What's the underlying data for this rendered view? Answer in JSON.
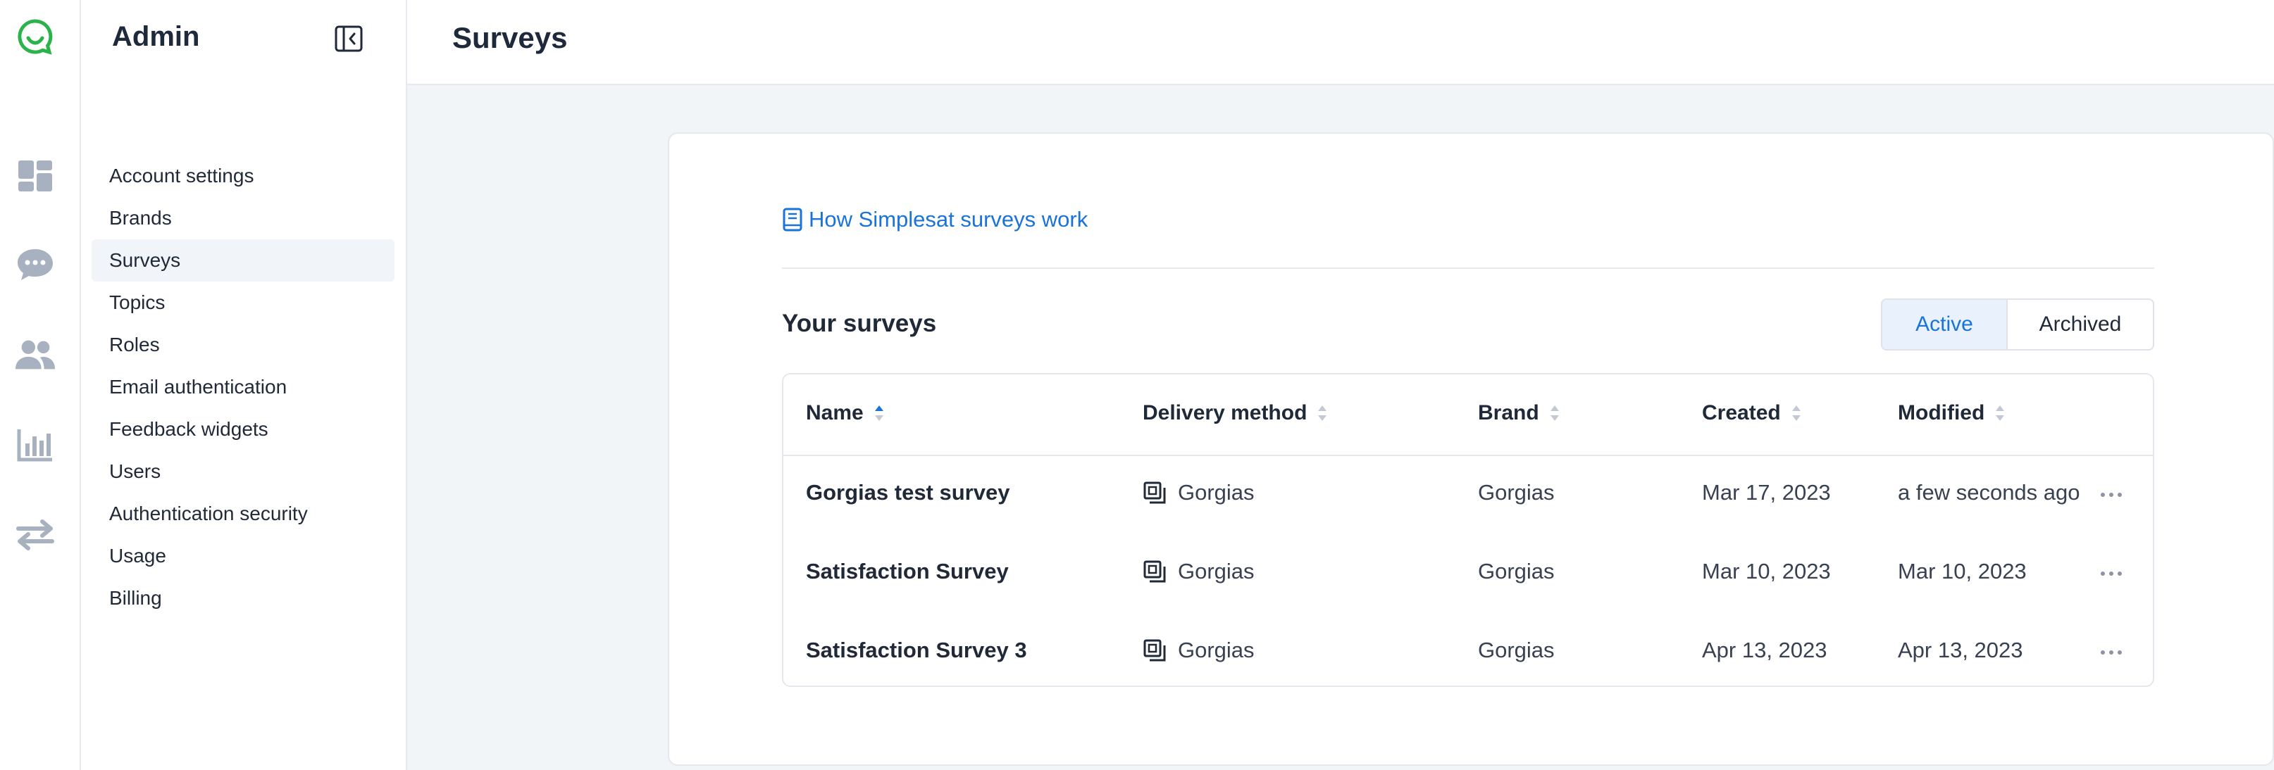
{
  "rail": {
    "icons": [
      "chat-logo-icon",
      "dashboard-icon",
      "conversations-icon",
      "people-icon",
      "analytics-icon",
      "integrations-icon"
    ],
    "colors": {
      "brand": "#2bb34b",
      "icon": "#a7b1bf"
    }
  },
  "sidebar": {
    "title": "Admin",
    "items": [
      {
        "label": "Account settings"
      },
      {
        "label": "Brands"
      },
      {
        "label": "Surveys"
      },
      {
        "label": "Topics"
      },
      {
        "label": "Roles"
      },
      {
        "label": "Email authentication"
      },
      {
        "label": "Feedback widgets"
      },
      {
        "label": "Users"
      },
      {
        "label": "Authentication security"
      },
      {
        "label": "Usage"
      },
      {
        "label": "Billing"
      }
    ],
    "active_item": "Surveys"
  },
  "header": {
    "title": "Surveys"
  },
  "main": {
    "help_link": "How Simplesat surveys work",
    "section_title": "Your surveys",
    "tabs": [
      {
        "label": "Active",
        "selected": true
      },
      {
        "label": "Archived",
        "selected": false
      }
    ],
    "table": {
      "columns": [
        "Name",
        "Delivery method",
        "Brand",
        "Created",
        "Modified"
      ],
      "rows": [
        {
          "name": "Gorgias test survey",
          "delivery": "Gorgias",
          "brand": "Gorgias",
          "created": "Mar 17, 2023",
          "modified": "a few seconds ago"
        },
        {
          "name": "Satisfaction Survey",
          "delivery": "Gorgias",
          "brand": "Gorgias",
          "created": "Mar 10, 2023",
          "modified": "Mar 10, 2023"
        },
        {
          "name": "Satisfaction Survey 3",
          "delivery": "Gorgias",
          "brand": "Gorgias",
          "created": "Apr 13, 2023",
          "modified": "Apr 13, 2023"
        }
      ]
    }
  },
  "colors": {
    "accent": "#1a73d9",
    "active_tab_bg": "#e8f1fc"
  }
}
